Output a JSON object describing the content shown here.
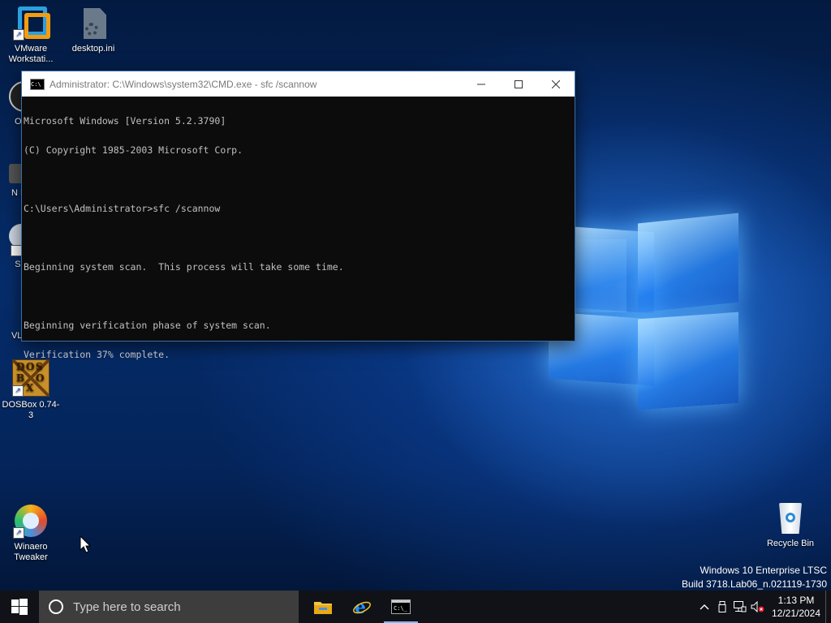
{
  "desktop": {
    "icons": [
      {
        "label": "VMware Workstati...",
        "icon": "vmware-icon"
      },
      {
        "label": "desktop.ini",
        "icon": "settings-file-icon"
      },
      {
        "label": "OB",
        "icon": "obs-icon"
      },
      {
        "label": "N Bor",
        "icon": "app-icon"
      },
      {
        "label": "Sup",
        "icon": "app-icon"
      },
      {
        "label": "VL player",
        "icon": "vlc-icon"
      },
      {
        "label": "DOSBox 0.74-3",
        "icon": "dosbox-icon"
      },
      {
        "label": "Winaero Tweaker",
        "icon": "winaero-icon"
      },
      {
        "label": "Recycle Bin",
        "icon": "recycle-bin-icon"
      }
    ],
    "dosbox_letters": [
      "D",
      "O",
      "S",
      "B",
      "O",
      "X"
    ]
  },
  "cmd": {
    "title": "Administrator: C:\\Windows\\system32\\CMD.exe - sfc  /scannow",
    "lines": [
      "Microsoft Windows [Version 5.2.3790]",
      "(C) Copyright 1985-2003 Microsoft Corp.",
      "",
      "C:\\Users\\Administrator>sfc /scannow",
      "",
      "Beginning system scan.  This process will take some time.",
      "",
      "Beginning verification phase of system scan.",
      "Verification 37% complete."
    ]
  },
  "wininfo": {
    "edition": "Windows 10 Enterprise LTSC",
    "build": "Build 3718.Lab06_n.021119-1730"
  },
  "taskbar": {
    "search_placeholder": "Type here to search",
    "time": "1:13 PM",
    "date": "12/21/2024"
  },
  "colors": {
    "taskbar": "#101217",
    "accent": "#7db7ff",
    "console_bg": "#0c0c0c",
    "console_fg": "#c0c0c0"
  }
}
